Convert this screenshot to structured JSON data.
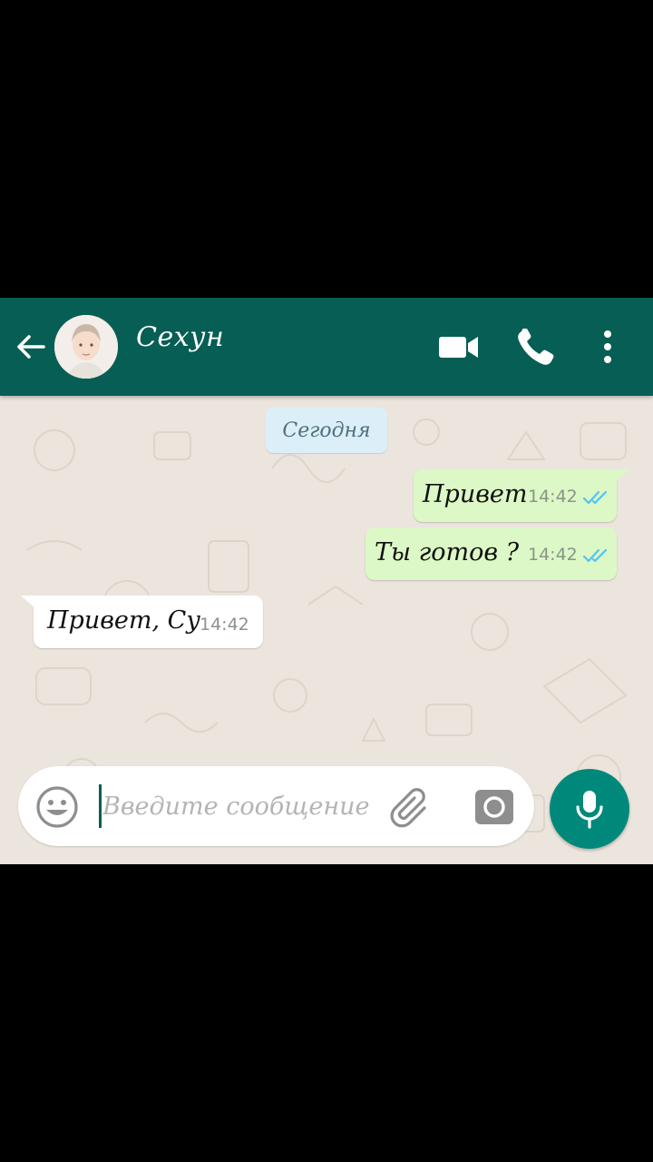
{
  "header": {
    "contact_name": "Сехун",
    "bar_color": "#075e54",
    "icons": {
      "back": "arrow-back-icon",
      "video": "video-camera-icon",
      "call": "phone-icon",
      "menu": "more-vertical-icon"
    }
  },
  "chat": {
    "date_label": "Сегодня",
    "messages": [
      {
        "direction": "outgoing",
        "text": "Привет",
        "time": "14:42",
        "status": "read"
      },
      {
        "direction": "outgoing",
        "text": "Ты готов ?",
        "time": "14:42",
        "status": "read"
      },
      {
        "direction": "incoming",
        "text": "Привет, Су",
        "time": "14:42"
      }
    ],
    "colors": {
      "outgoing_bubble": "#dcf8c6",
      "incoming_bubble": "#ffffff",
      "read_ticks": "#4fc3f7"
    }
  },
  "composer": {
    "placeholder": "Введите сообщение",
    "value": "",
    "icons": {
      "emoji": "emoji-smile-icon",
      "attach": "paperclip-icon",
      "camera": "camera-icon",
      "mic": "microphone-icon"
    },
    "mic_color": "#00897b"
  }
}
